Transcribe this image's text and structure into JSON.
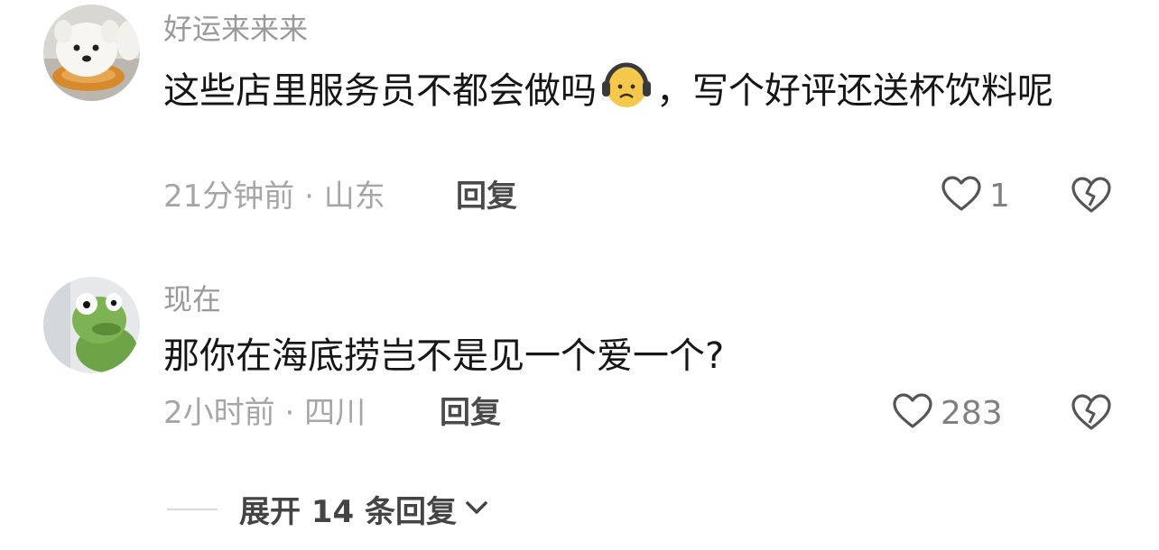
{
  "comments": [
    {
      "username": "好运来来来",
      "text_part1": "这些店里服务员不都会做吗",
      "emoji_icon": "headphones-frown-emoji",
      "text_part2": "，写个好评还送杯饮料呢",
      "time": "21分钟前",
      "separator": "·",
      "location": "山东",
      "reply_label": "回复",
      "likes": "1"
    },
    {
      "username": "现在",
      "text": "那你在海底捞岂不是见一个爱一个?",
      "time": "2小时前",
      "separator": "·",
      "location": "四川",
      "reply_label": "回复",
      "likes": "283"
    }
  ],
  "expand": {
    "label": "展开 14 条回复"
  },
  "colors": {
    "muted": "#a6a6a6",
    "text": "#161616",
    "icon": "#555555"
  }
}
